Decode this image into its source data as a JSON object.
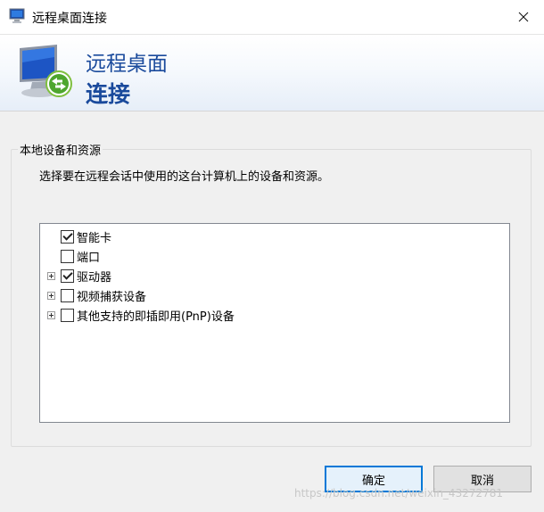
{
  "window": {
    "title": "远程桌面连接"
  },
  "banner": {
    "line1": "远程桌面",
    "line2": "连接"
  },
  "group": {
    "legend": "本地设备和资源",
    "description": "选择要在远程会话中使用的这台计算机上的设备和资源。",
    "items": [
      {
        "label": "智能卡",
        "checked": true,
        "expandable": false
      },
      {
        "label": "端口",
        "checked": false,
        "expandable": false
      },
      {
        "label": "驱动器",
        "checked": true,
        "expandable": true
      },
      {
        "label": "视频捕获设备",
        "checked": false,
        "expandable": true
      },
      {
        "label": "其他支持的即插即用(PnP)设备",
        "checked": false,
        "expandable": true
      }
    ]
  },
  "buttons": {
    "ok": "确定",
    "cancel": "取消"
  },
  "watermark": "https://blog.csdn.net/weixin_43272781"
}
